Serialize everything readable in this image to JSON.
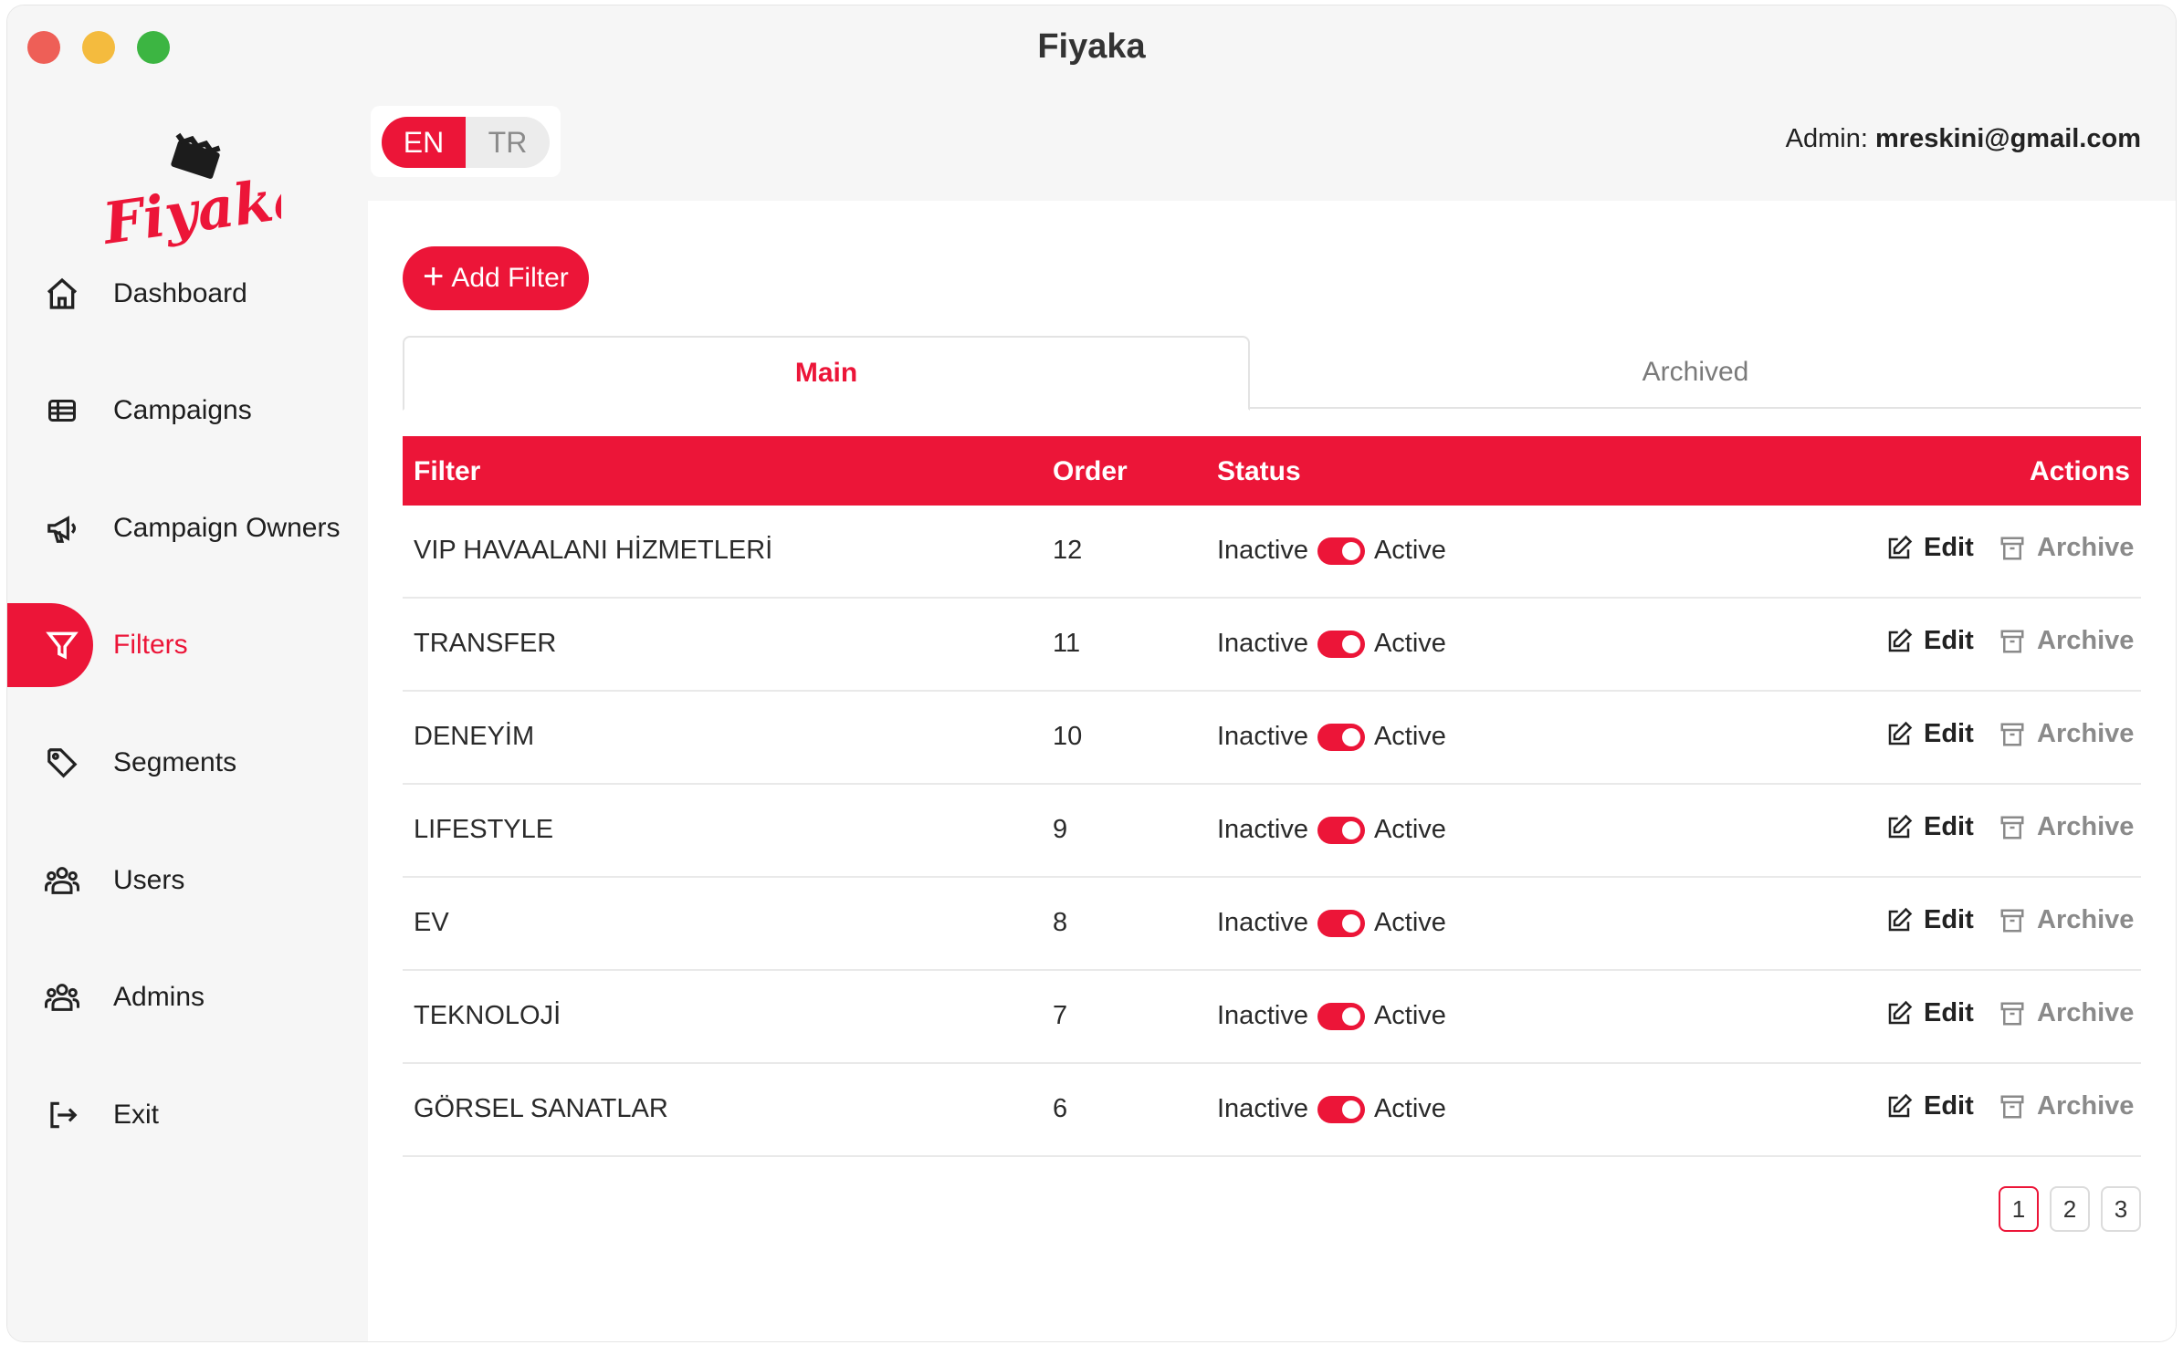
{
  "window": {
    "title": "Fiyaka"
  },
  "brand": {
    "logo_text": "Fiyaka",
    "accent": "#ec1538"
  },
  "sidebar": {
    "items": [
      {
        "label": "Dashboard",
        "icon": "home-icon",
        "active": false
      },
      {
        "label": "Campaigns",
        "icon": "table-icon",
        "active": false
      },
      {
        "label": "Campaign Owners",
        "icon": "megaphone-icon",
        "active": false
      },
      {
        "label": "Filters",
        "icon": "funnel-icon",
        "active": true
      },
      {
        "label": "Segments",
        "icon": "tag-icon",
        "active": false
      },
      {
        "label": "Users",
        "icon": "users-icon",
        "active": false
      },
      {
        "label": "Admins",
        "icon": "users-icon",
        "active": false
      },
      {
        "label": "Exit",
        "icon": "logout-icon",
        "active": false
      }
    ]
  },
  "topbar": {
    "lang": {
      "en": "EN",
      "tr": "TR",
      "selected": "EN"
    },
    "admin_label": "Admin:",
    "admin_email": "mreskini@gmail.com"
  },
  "toolbar": {
    "add_filter_label": "Add Filter"
  },
  "tabs": {
    "main": "Main",
    "archived": "Archived",
    "selected": "Main"
  },
  "table": {
    "headers": {
      "filter": "Filter",
      "order": "Order",
      "status": "Status",
      "actions": "Actions"
    },
    "status_labels": {
      "inactive": "Inactive",
      "active": "Active"
    },
    "action_labels": {
      "edit": "Edit",
      "archive": "Archive"
    },
    "rows": [
      {
        "filter": "VIP HAVAALANI HİZMETLERİ",
        "order": "12",
        "active": true
      },
      {
        "filter": "TRANSFER",
        "order": "11",
        "active": true
      },
      {
        "filter": "DENEYİM",
        "order": "10",
        "active": true
      },
      {
        "filter": "LIFESTYLE",
        "order": "9",
        "active": true
      },
      {
        "filter": "EV",
        "order": "8",
        "active": true
      },
      {
        "filter": "TEKNOLOJİ",
        "order": "7",
        "active": true
      },
      {
        "filter": "GÖRSEL SANATLAR",
        "order": "6",
        "active": true
      }
    ]
  },
  "pagination": {
    "pages": [
      "1",
      "2",
      "3"
    ],
    "current": "1"
  }
}
